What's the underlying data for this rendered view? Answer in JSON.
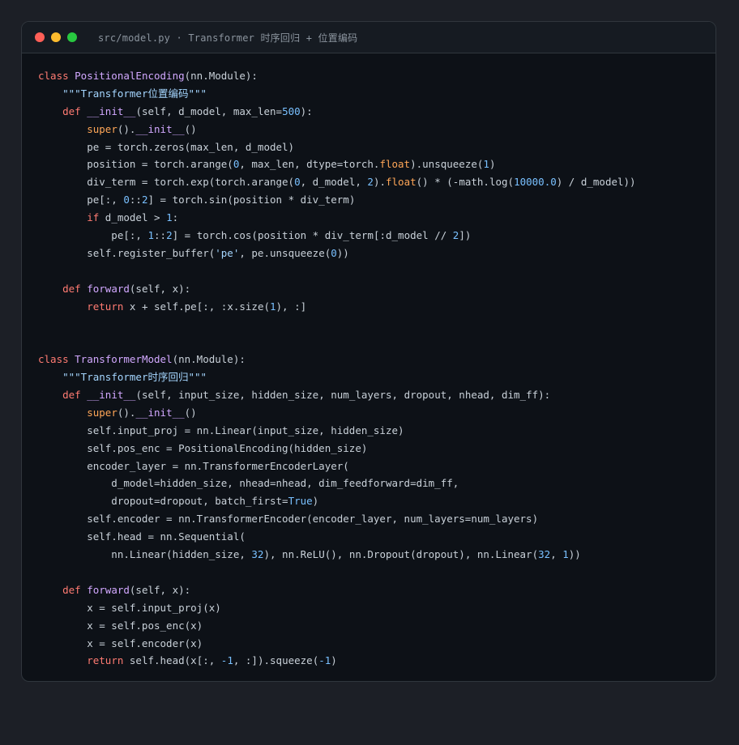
{
  "window": {
    "title": "src/model.py · Transformer 时序回归 + 位置编码",
    "controls": [
      {
        "name": "close",
        "color": "#ff5f57"
      },
      {
        "name": "minimize",
        "color": "#febc2e"
      },
      {
        "name": "maximize",
        "color": "#28c840"
      }
    ]
  },
  "colors": {
    "keyword": "#ff7b72",
    "function": "#d2a8ff",
    "string": "#a5d6ff",
    "number": "#79c0ff",
    "builtin": "#ffa657",
    "text": "#c9d1d9",
    "background": "#0d1117"
  },
  "code": {
    "language": "python",
    "lines": [
      [
        [
          "kw",
          "class "
        ],
        [
          "fn",
          "PositionalEncoding"
        ],
        [
          "t",
          "(nn.Module):"
        ]
      ],
      [
        [
          "t",
          "    "
        ],
        [
          "str",
          "\"\"\"Transformer位置编码\"\"\""
        ]
      ],
      [
        [
          "t",
          "    "
        ],
        [
          "kw",
          "def "
        ],
        [
          "fn",
          "__init__"
        ],
        [
          "t",
          "(self, d_model, max_len="
        ],
        [
          "num",
          "500"
        ],
        [
          "t",
          "):"
        ]
      ],
      [
        [
          "t",
          "        "
        ],
        [
          "blt",
          "super"
        ],
        [
          "t",
          "()."
        ],
        [
          "fn",
          "__init__"
        ],
        [
          "t",
          "()"
        ]
      ],
      [
        [
          "t",
          "        pe = torch.zeros(max_len, d_model)"
        ]
      ],
      [
        [
          "t",
          "        position = torch.arange("
        ],
        [
          "num",
          "0"
        ],
        [
          "t",
          ", max_len, dtype=torch."
        ],
        [
          "blt",
          "float"
        ],
        [
          "t",
          ").unsqueeze("
        ],
        [
          "num",
          "1"
        ],
        [
          "t",
          ")"
        ]
      ],
      [
        [
          "t",
          "        div_term = torch.exp(torch.arange("
        ],
        [
          "num",
          "0"
        ],
        [
          "t",
          ", d_model, "
        ],
        [
          "num",
          "2"
        ],
        [
          "t",
          ")."
        ],
        [
          "blt",
          "float"
        ],
        [
          "t",
          "() * (-math.log("
        ],
        [
          "num",
          "10000.0"
        ],
        [
          "t",
          ") / d_model))"
        ]
      ],
      [
        [
          "t",
          "        pe[:, "
        ],
        [
          "num",
          "0"
        ],
        [
          "t",
          "::"
        ],
        [
          "num",
          "2"
        ],
        [
          "t",
          "] = torch.sin(position * div_term)"
        ]
      ],
      [
        [
          "t",
          "        "
        ],
        [
          "kw",
          "if "
        ],
        [
          "t",
          "d_model > "
        ],
        [
          "num",
          "1"
        ],
        [
          "t",
          ":"
        ]
      ],
      [
        [
          "t",
          "            pe[:, "
        ],
        [
          "num",
          "1"
        ],
        [
          "t",
          "::"
        ],
        [
          "num",
          "2"
        ],
        [
          "t",
          "] = torch.cos(position * div_term[:d_model // "
        ],
        [
          "num",
          "2"
        ],
        [
          "t",
          "])"
        ]
      ],
      [
        [
          "t",
          "        self.register_buffer("
        ],
        [
          "str",
          "'pe'"
        ],
        [
          "t",
          ", pe.unsqueeze("
        ],
        [
          "num",
          "0"
        ],
        [
          "t",
          "))"
        ]
      ],
      [],
      [
        [
          "t",
          "    "
        ],
        [
          "kw",
          "def "
        ],
        [
          "fn",
          "forward"
        ],
        [
          "t",
          "(self, x):"
        ]
      ],
      [
        [
          "t",
          "        "
        ],
        [
          "kw",
          "return "
        ],
        [
          "t",
          "x + self.pe[:, :x.size("
        ],
        [
          "num",
          "1"
        ],
        [
          "t",
          "), :]"
        ]
      ],
      [],
      [],
      [
        [
          "kw",
          "class "
        ],
        [
          "fn",
          "TransformerModel"
        ],
        [
          "t",
          "(nn.Module):"
        ]
      ],
      [
        [
          "t",
          "    "
        ],
        [
          "str",
          "\"\"\"Transformer时序回归\"\"\""
        ]
      ],
      [
        [
          "t",
          "    "
        ],
        [
          "kw",
          "def "
        ],
        [
          "fn",
          "__init__"
        ],
        [
          "t",
          "(self, input_size, hidden_size, num_layers, dropout, nhead, dim_ff):"
        ]
      ],
      [
        [
          "t",
          "        "
        ],
        [
          "blt",
          "super"
        ],
        [
          "t",
          "()."
        ],
        [
          "fn",
          "__init__"
        ],
        [
          "t",
          "()"
        ]
      ],
      [
        [
          "t",
          "        self.input_proj = nn.Linear(input_size, hidden_size)"
        ]
      ],
      [
        [
          "t",
          "        self.pos_enc = PositionalEncoding(hidden_size)"
        ]
      ],
      [
        [
          "t",
          "        encoder_layer = nn.TransformerEncoderLayer("
        ]
      ],
      [
        [
          "t",
          "            d_model=hidden_size, nhead=nhead, dim_feedforward=dim_ff,"
        ]
      ],
      [
        [
          "t",
          "            dropout=dropout, batch_first="
        ],
        [
          "num",
          "True"
        ],
        [
          "t",
          ")"
        ]
      ],
      [
        [
          "t",
          "        self.encoder = nn.TransformerEncoder(encoder_layer, num_layers=num_layers)"
        ]
      ],
      [
        [
          "t",
          "        self.head = nn.Sequential("
        ]
      ],
      [
        [
          "t",
          "            nn.Linear(hidden_size, "
        ],
        [
          "num",
          "32"
        ],
        [
          "t",
          "), nn.ReLU(), nn.Dropout(dropout), nn.Linear("
        ],
        [
          "num",
          "32"
        ],
        [
          "t",
          ", "
        ],
        [
          "num",
          "1"
        ],
        [
          "t",
          "))"
        ]
      ],
      [],
      [
        [
          "t",
          "    "
        ],
        [
          "kw",
          "def "
        ],
        [
          "fn",
          "forward"
        ],
        [
          "t",
          "(self, x):"
        ]
      ],
      [
        [
          "t",
          "        x = self.input_proj(x)"
        ]
      ],
      [
        [
          "t",
          "        x = self.pos_enc(x)"
        ]
      ],
      [
        [
          "t",
          "        x = self.encoder(x)"
        ]
      ],
      [
        [
          "t",
          "        "
        ],
        [
          "kw",
          "return "
        ],
        [
          "t",
          "self.head(x[:, "
        ],
        [
          "num",
          "-1"
        ],
        [
          "t",
          ", :]).squeeze("
        ],
        [
          "num",
          "-1"
        ],
        [
          "t",
          ")"
        ]
      ]
    ]
  }
}
